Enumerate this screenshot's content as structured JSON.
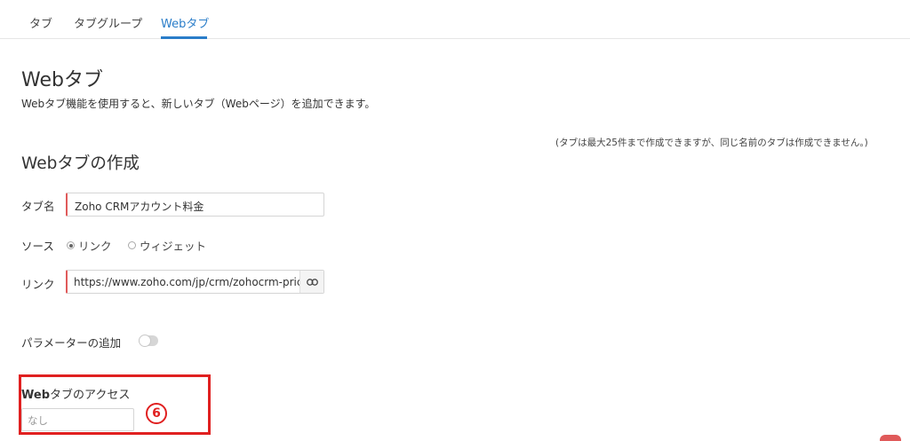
{
  "tabs": [
    {
      "label": "タブ"
    },
    {
      "label": "タブグループ"
    },
    {
      "label": "Webタブ"
    }
  ],
  "page": {
    "title": "Webタブ",
    "description": "Webタブ機能を使用すると、新しいタブ（Webページ）を追加できます。",
    "note": "(タブは最大25件まで作成できますが、同じ名前のタブは作成できません。)"
  },
  "form": {
    "section_title": "Webタブの作成",
    "tab_name_label": "タブ名",
    "tab_name_value": "Zoho CRMアカウント料金",
    "source_label": "ソース",
    "source_options": [
      "リンク",
      "ウィジェット"
    ],
    "source_selected": "リンク",
    "link_label": "リンク",
    "link_value": "https://www.zoho.com/jp/crm/zohocrm-pricing.html",
    "params_label": "パラメーターの追加",
    "params_enabled": false,
    "access_label_bold": "Web",
    "access_label_rest": "タブのアクセス",
    "access_placeholder": "なし",
    "step_badge": "6"
  },
  "icons": {
    "link_button": "link-icon"
  },
  "colors": {
    "accent": "#2a7dc9",
    "required": "#e05a5a",
    "highlight": "#e02020"
  }
}
